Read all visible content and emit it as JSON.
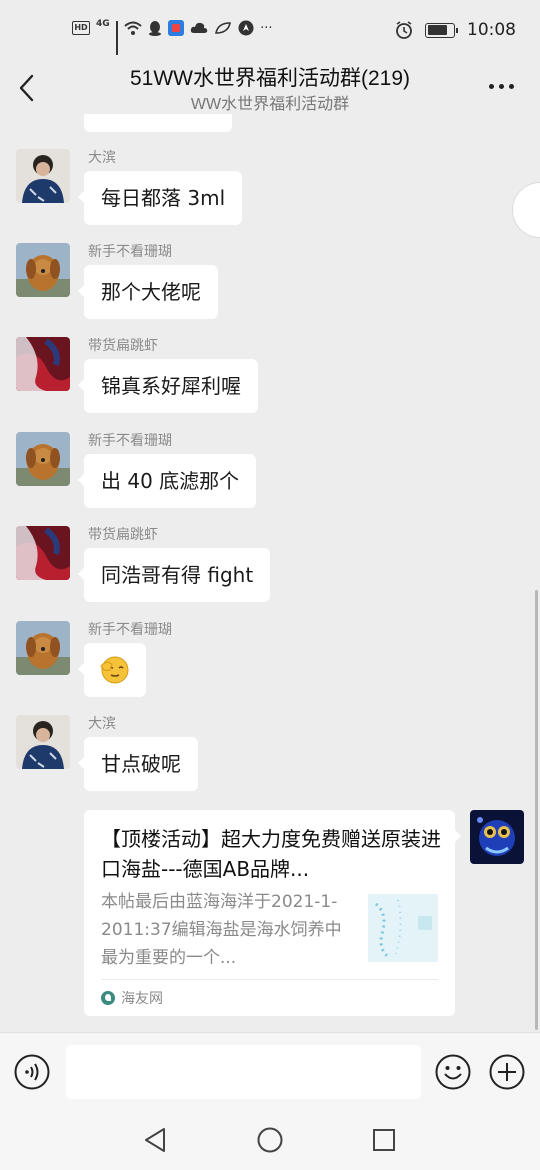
{
  "status_bar": {
    "hd": "HD",
    "network": "4G",
    "more_dots": "···",
    "time": "10:08"
  },
  "header": {
    "title": "51WW水世界福利活动群(219)",
    "subtitle": "WW水世界福利活动群"
  },
  "messages": [
    {
      "sender": "大滨",
      "text": "每日都落 3ml"
    },
    {
      "sender": "新手不看珊瑚",
      "text": "那个大佬呢"
    },
    {
      "sender": "带货扁跳虾",
      "text": "锦真系好犀利喔"
    },
    {
      "sender": "新手不看珊瑚",
      "text": "出 40 底滤那个"
    },
    {
      "sender": "带货扁跳虾",
      "text": "同浩哥有得 fight"
    },
    {
      "sender": "新手不看珊瑚",
      "text": ""
    },
    {
      "sender": "大滨",
      "text": "甘点破呢"
    }
  ],
  "shared_card": {
    "title": "【顶楼活动】超大力度免费赠送原装进口海盐---德国AB品牌...",
    "description": "本帖最后由蓝海海洋于2021-1-2011:37编辑海盐是海水饲养中最为重要的一个...",
    "source": "海友网"
  },
  "input": {
    "value": "",
    "placeholder": ""
  }
}
